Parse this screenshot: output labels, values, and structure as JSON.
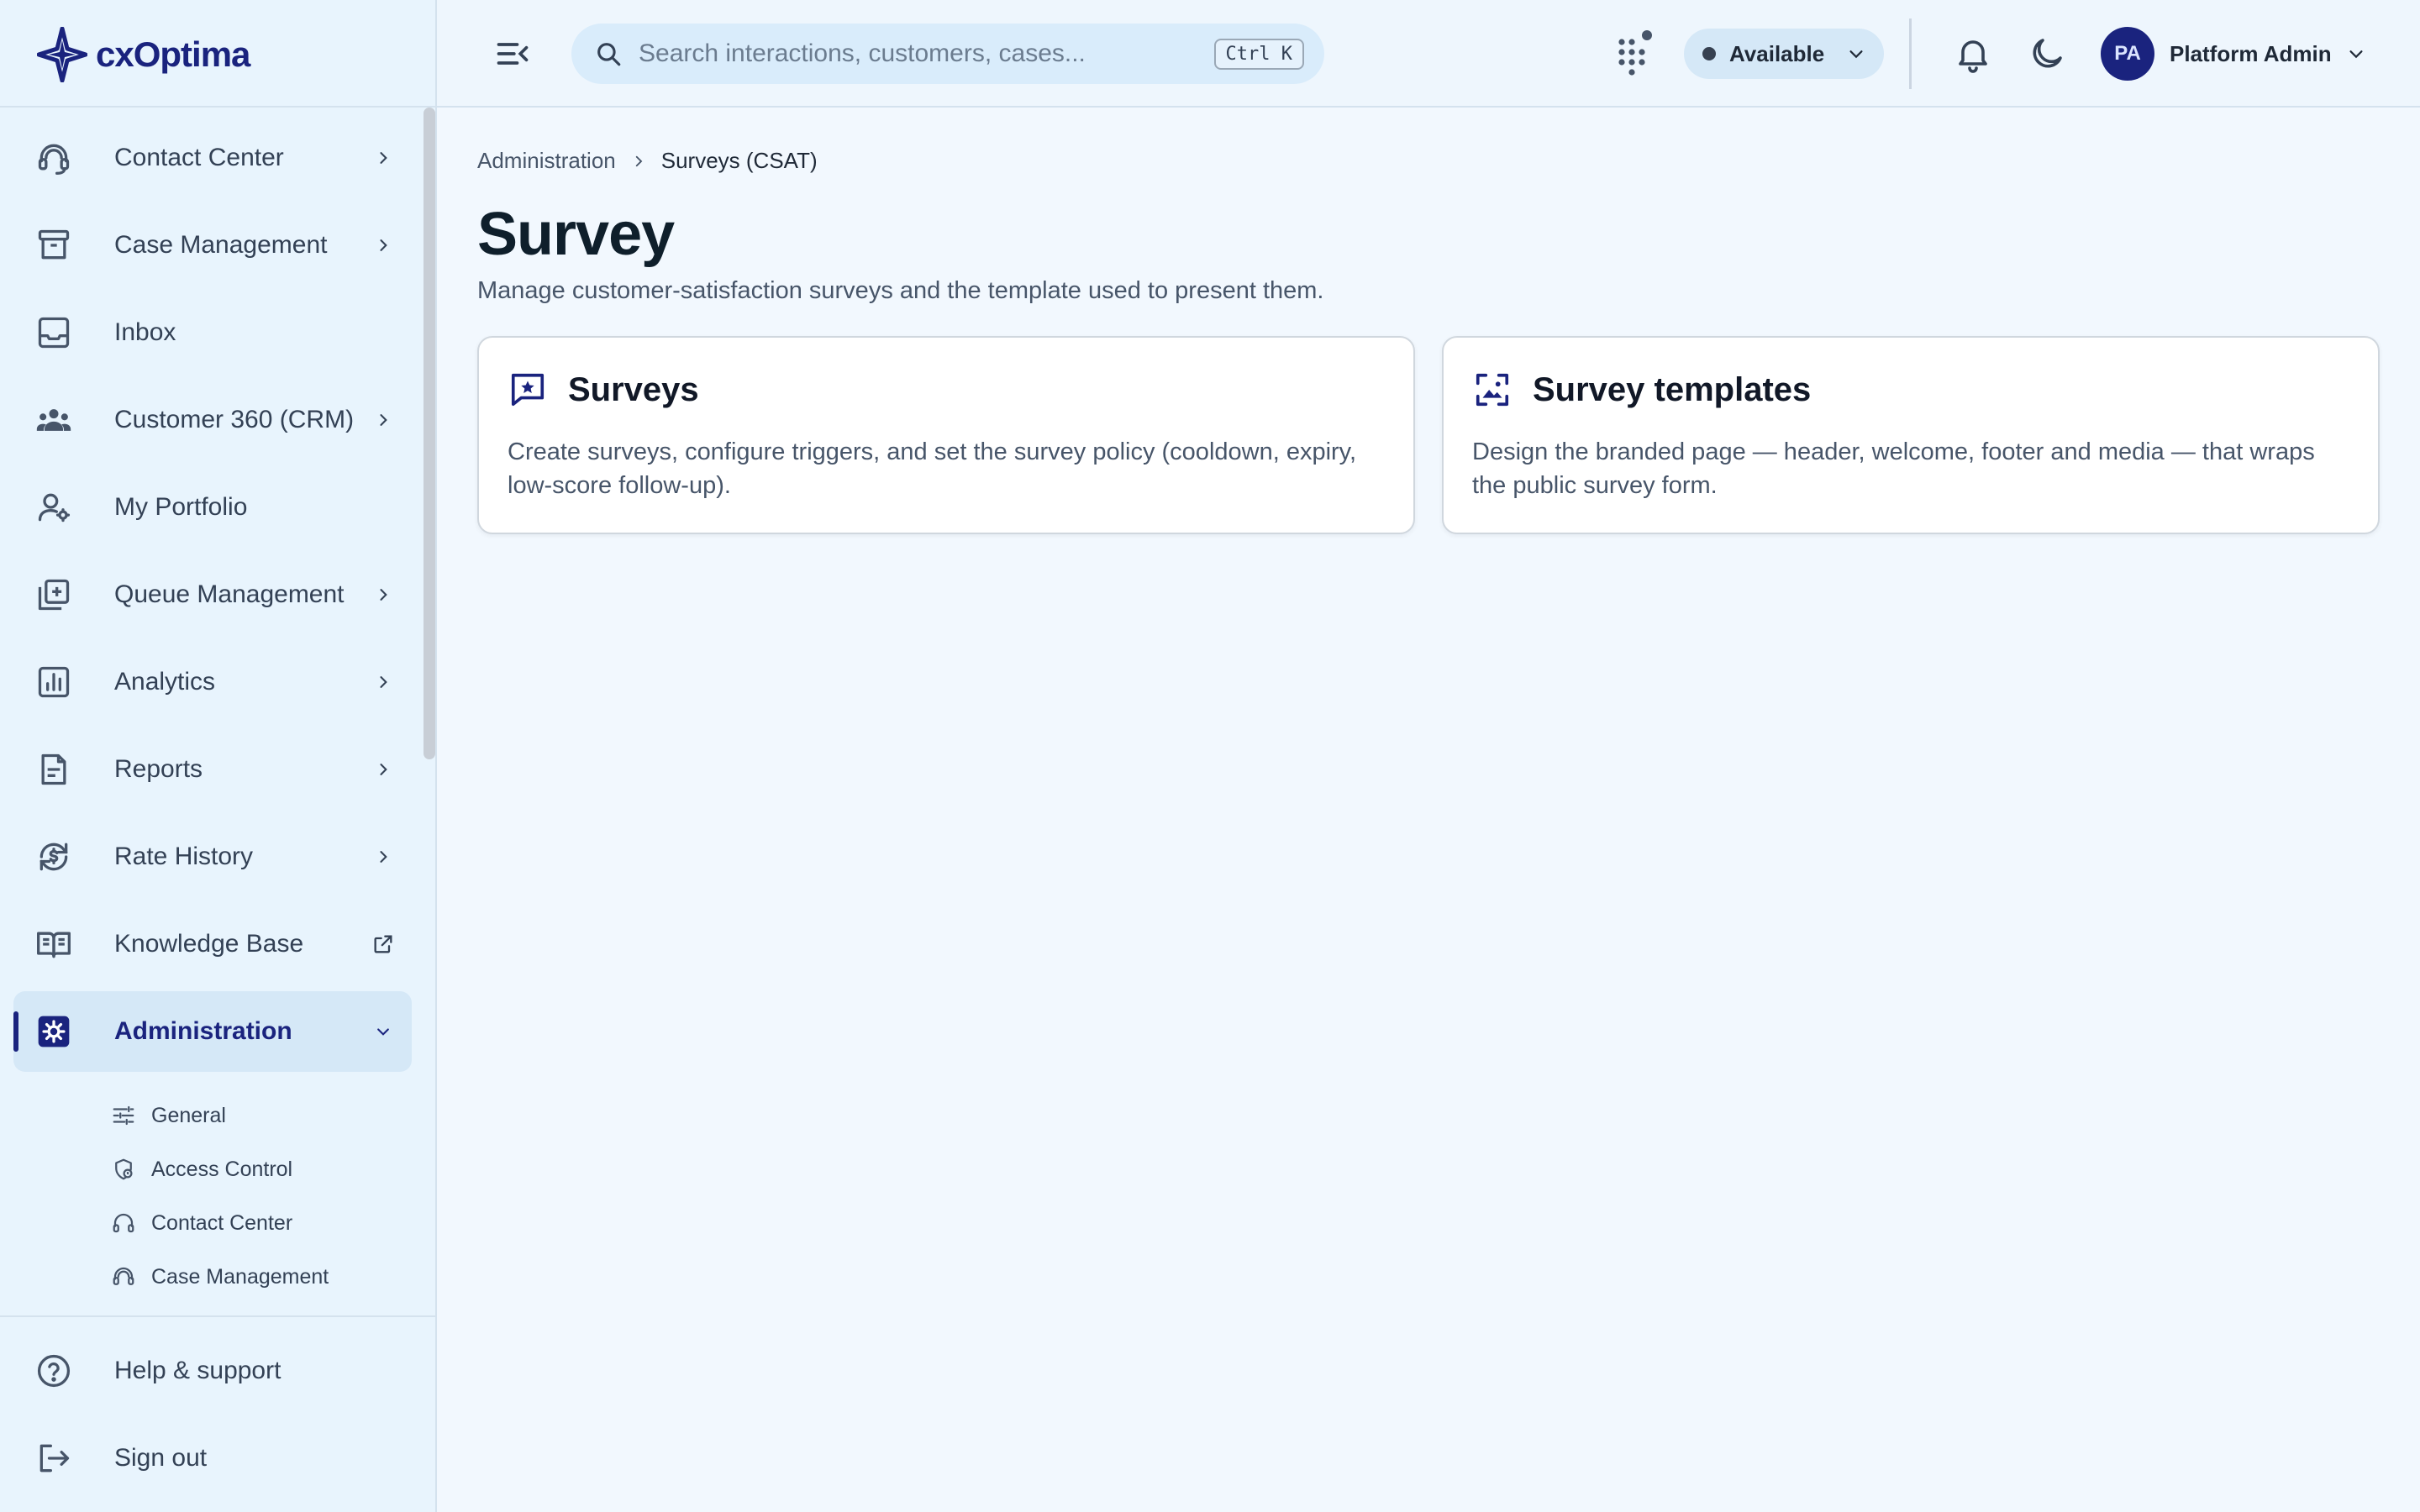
{
  "brand": {
    "name": "cxOptima",
    "color": "#1a237e"
  },
  "sidebar": {
    "items": [
      {
        "label": "Contact Center",
        "icon": "headset-icon",
        "chevron": true
      },
      {
        "label": "Case Management",
        "icon": "archive-box-icon",
        "chevron": true
      },
      {
        "label": "Inbox",
        "icon": "inbox-tray-icon",
        "chevron": false
      },
      {
        "label": "Customer 360 (CRM)",
        "icon": "people-group-icon",
        "chevron": true
      },
      {
        "label": "My Portfolio",
        "icon": "person-settings-icon",
        "chevron": false
      },
      {
        "label": "Queue Management",
        "icon": "queue-add-icon",
        "chevron": true
      },
      {
        "label": "Analytics",
        "icon": "bar-chart-icon",
        "chevron": true
      },
      {
        "label": "Reports",
        "icon": "report-document-icon",
        "chevron": true
      },
      {
        "label": "Rate History",
        "icon": "currency-history-icon",
        "chevron": true
      },
      {
        "label": "Knowledge Base",
        "icon": "open-book-icon",
        "external": true
      },
      {
        "label": "Administration",
        "icon": "admin-gear-icon",
        "active": true,
        "expanded": true
      }
    ],
    "sub_items": [
      {
        "label": "General",
        "icon": "sliders-icon"
      },
      {
        "label": "Access Control",
        "icon": "shield-lock-icon"
      },
      {
        "label": "Contact Center",
        "icon": "headphones-icon"
      },
      {
        "label": "Case Management",
        "icon": "headset-icon"
      }
    ],
    "bottom": [
      {
        "label": "Help & support",
        "icon": "help-circle-icon"
      },
      {
        "label": "Sign out",
        "icon": "logout-icon"
      }
    ]
  },
  "topbar": {
    "search_placeholder": "Search interactions, customers, cases...",
    "search_shortcut": "Ctrl K",
    "status": "Available",
    "user": {
      "initials": "PA",
      "name": "Platform Admin"
    }
  },
  "breadcrumb": {
    "parent": "Administration",
    "current": "Surveys (CSAT)"
  },
  "page": {
    "title": "Survey",
    "subtitle": "Manage customer-satisfaction surveys and the template used to present them."
  },
  "cards": [
    {
      "title": "Surveys",
      "icon": "star-chat-icon",
      "description": "Create surveys, configure triggers, and set the survey policy (cooldown, expiry, low-score follow-up)."
    },
    {
      "title": "Survey templates",
      "icon": "image-frame-icon",
      "description": "Design the branded page — header, welcome, footer and media — that wraps the public survey form."
    }
  ]
}
